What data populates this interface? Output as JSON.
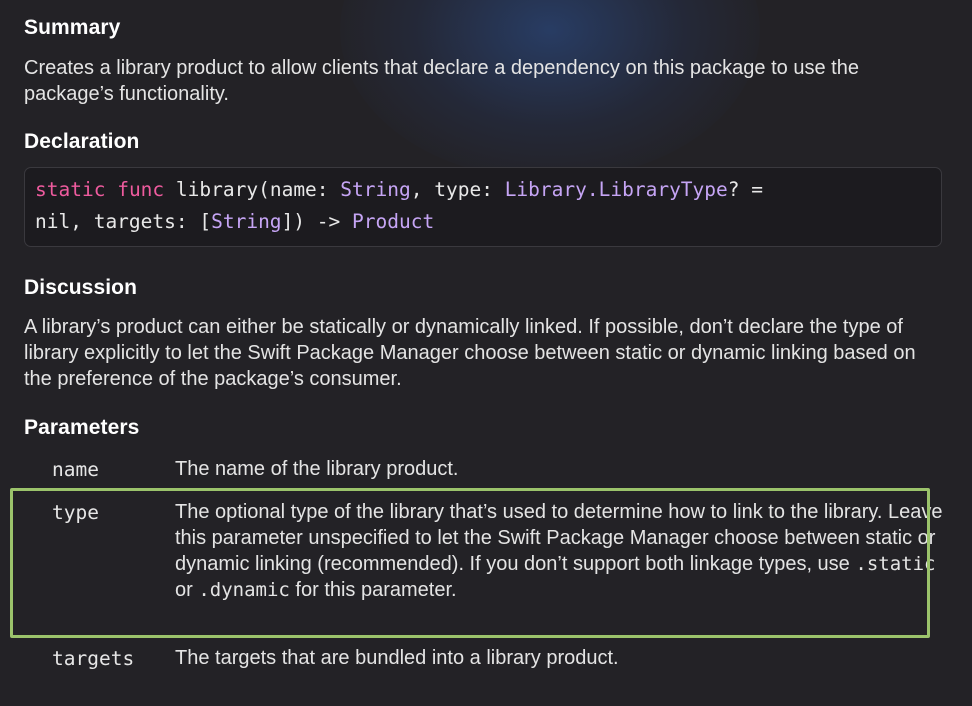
{
  "summary": {
    "title": "Summary",
    "text": "Creates a library product to allow clients that declare a dependency on this package to use the package’s functionality."
  },
  "declaration": {
    "title": "Declaration",
    "line1": {
      "kw_static": "static",
      "kw_func": "func",
      "name": "library(name:",
      "type_string": "String",
      "comma_type": ", type:",
      "type_library": "Library",
      "dot": ".",
      "type_librarytype": "LibraryType",
      "optional_eq": "? ="
    },
    "line2": {
      "nil_targets": "nil, targets: [",
      "type_string": "String",
      "close_arrow": "]) ->",
      "type_product": "Product"
    }
  },
  "discussion": {
    "title": "Discussion",
    "text": "A library’s product can either be statically or dynamically linked. If possible, don’t declare the type of library explicitly to let the Swift Package Manager choose between static or dynamic linking based on the preference of the package’s consumer."
  },
  "parameters": {
    "title": "Parameters",
    "items": [
      {
        "name": "name",
        "desc": "The name of the library product."
      },
      {
        "name": "type",
        "desc_before": "The optional type of the library that’s used to determine how to link to the library. Leave this parameter unspecified to let the Swift Package Manager choose between static or dynamic linking (recommended). If you don’t support both linkage types, use ",
        "code_static": ".static",
        "desc_or": " or ",
        "code_dynamic": ".dynamic",
        "desc_after": " for this parameter."
      },
      {
        "name": "targets",
        "desc": "The targets that are bundled into a library product."
      }
    ]
  },
  "colors": {
    "background": "#232226",
    "keyword": "#ee5b9e",
    "type": "#c6a5f5",
    "highlight_border": "#9bc36b"
  }
}
